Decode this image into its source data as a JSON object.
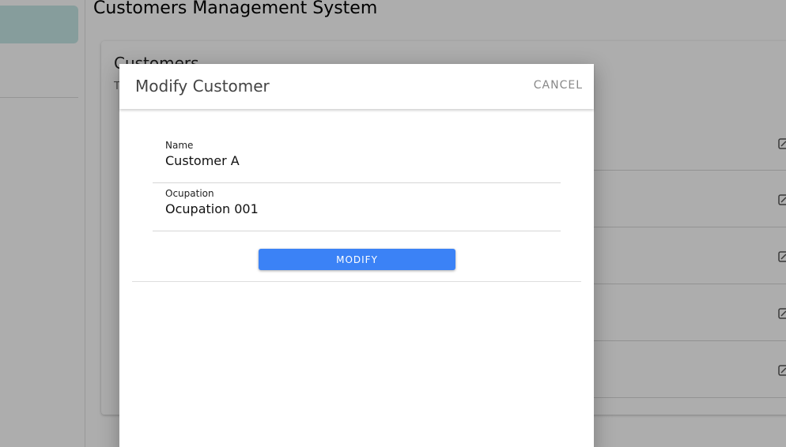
{
  "page": {
    "title": "Customers Management System"
  },
  "card": {
    "title": "Customers",
    "subtitle": "T"
  },
  "dialog": {
    "title": "Modify Customer",
    "cancel_label": "CANCEL",
    "fields": [
      {
        "label": "Name",
        "value": "Customer A"
      },
      {
        "label": "Ocupation",
        "value": "Ocupation 001"
      }
    ],
    "submit_label": "MODIFY"
  },
  "colors": {
    "primary": "#3b82f6",
    "sidebar_active": "#c6e8e6"
  },
  "icons": {
    "row_action": "edit-icon"
  }
}
